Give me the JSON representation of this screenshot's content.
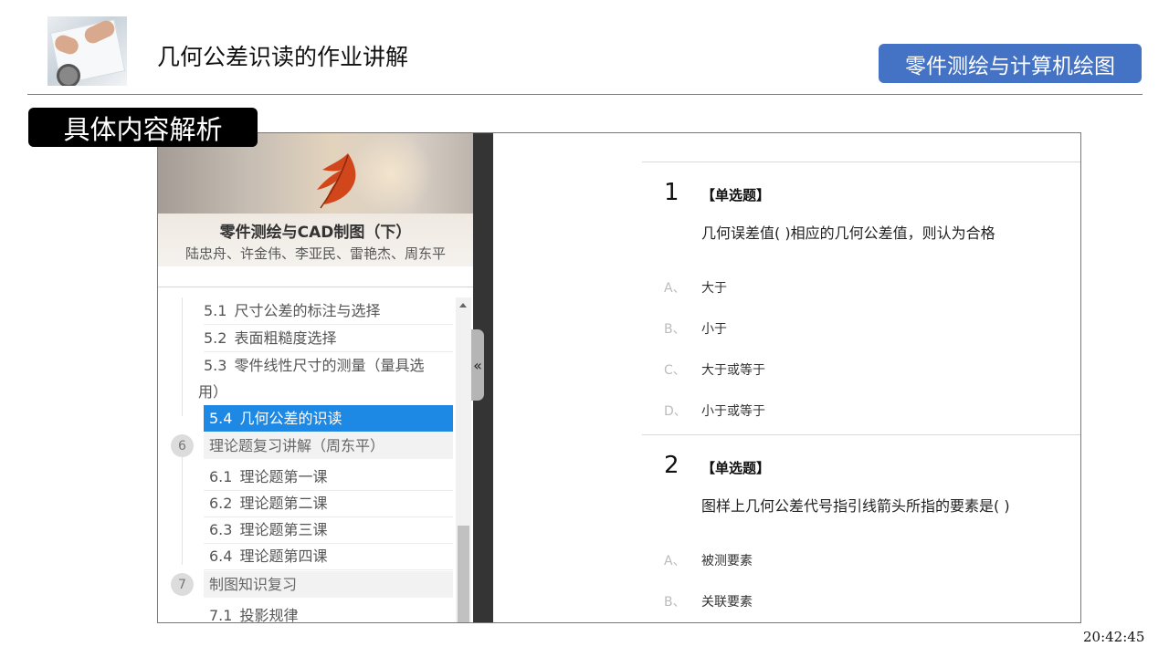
{
  "header": {
    "title": "几何公差识读的作业讲解",
    "course_badge": "零件测绘与计算机绘图",
    "section_label": "具体内容解析"
  },
  "sidebar": {
    "book_title": "零件测绘与CAD制图（下）",
    "book_authors": "陆忠舟、许金伟、李亚民、雷艳杰、周东平",
    "collapse_label": "«",
    "toc": [
      {
        "num": "5.1",
        "label": "尺寸公差的标注与选择",
        "active": false
      },
      {
        "num": "5.2",
        "label": "表面粗糙度选择",
        "active": false
      },
      {
        "num": "5.3",
        "label": "零件线性尺寸的测量（量具选",
        "label_cont": "用）",
        "active": false
      },
      {
        "num": "5.4",
        "label": "几何公差的识读",
        "active": true
      },
      {
        "chapter": "6",
        "label": "理论题复习讲解（周东平）"
      },
      {
        "num": "6.1",
        "label": "理论题第一课",
        "active": false
      },
      {
        "num": "6.2",
        "label": "理论题第二课",
        "active": false
      },
      {
        "num": "6.3",
        "label": "理论题第三课",
        "active": false
      },
      {
        "num": "6.4",
        "label": "理论题第四课",
        "active": false
      },
      {
        "chapter": "7",
        "label": "制图知识复习"
      },
      {
        "num": "7.1",
        "label": "投影规律",
        "active": false
      }
    ]
  },
  "questions": [
    {
      "number": "1",
      "type": "【单选题】",
      "text": "几何误差值(   )相应的几何公差值，则认为合格",
      "options": [
        {
          "letter": "A、",
          "text": "大于"
        },
        {
          "letter": "B、",
          "text": "小于"
        },
        {
          "letter": "C、",
          "text": "大于或等于"
        },
        {
          "letter": "D、",
          "text": "小于或等于"
        }
      ]
    },
    {
      "number": "2",
      "type": "【单选题】",
      "text": "图样上几何公差代号指引线箭头所指的要素是(   )",
      "options": [
        {
          "letter": "A、",
          "text": "被测要素"
        },
        {
          "letter": "B、",
          "text": "关联要素"
        }
      ]
    }
  ],
  "timestamp": "20:42:45",
  "colors": {
    "badge": "#4472c4",
    "active_item": "#1e88e5",
    "section_label_bg": "#000000",
    "collapse_strip": "#343434"
  }
}
